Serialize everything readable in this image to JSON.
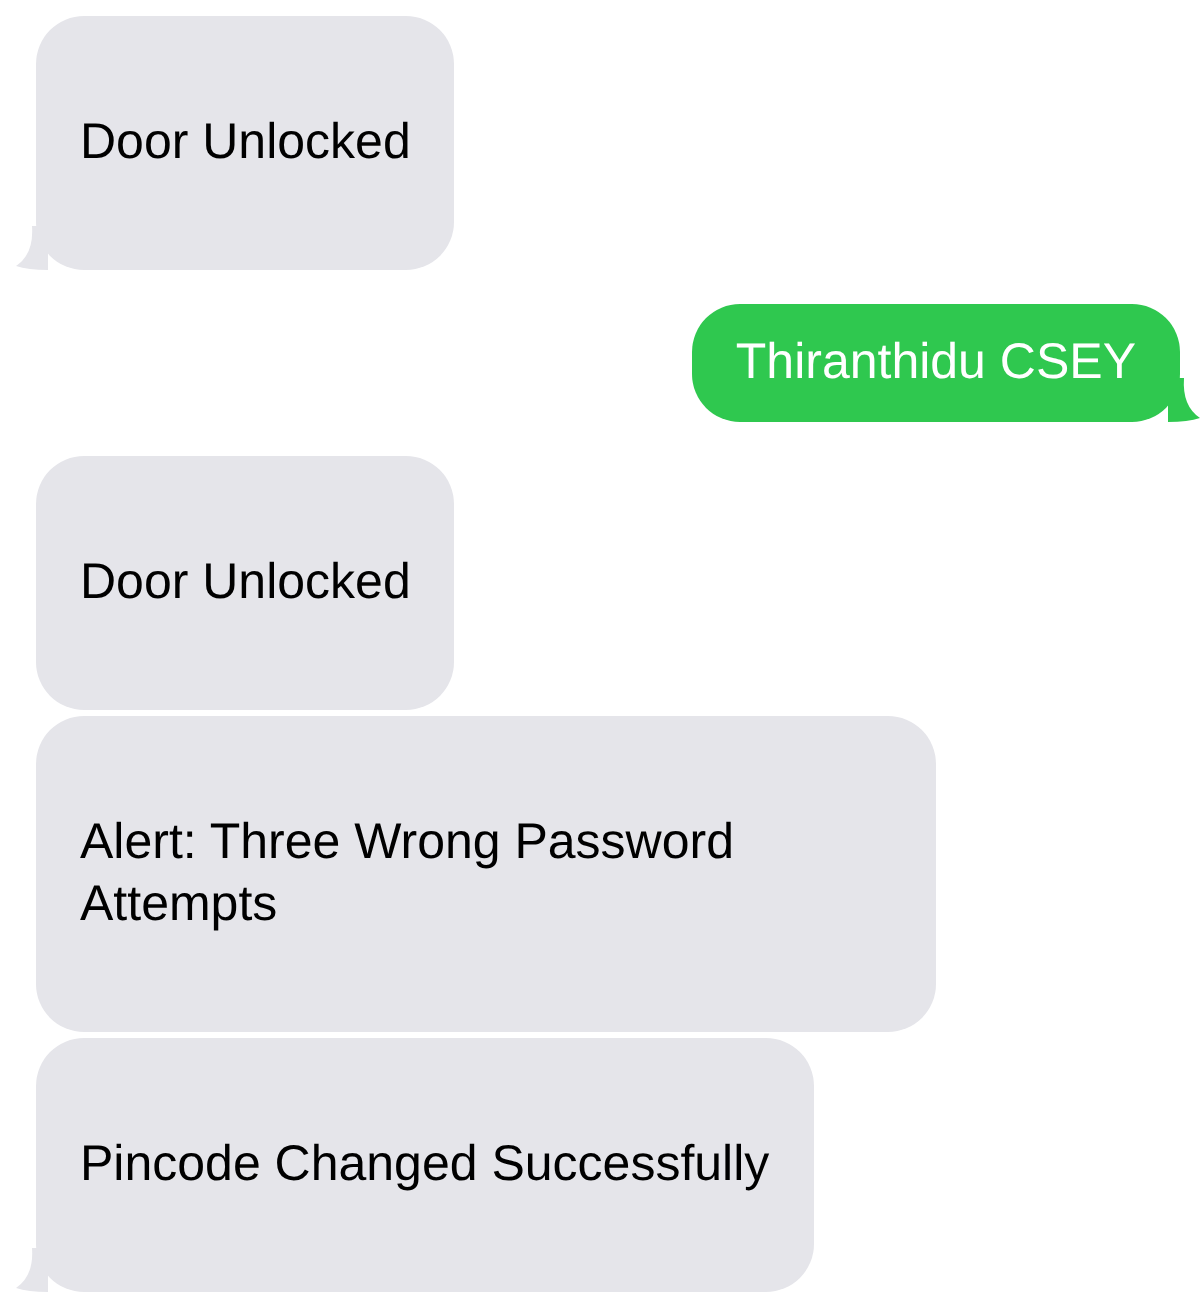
{
  "messages": [
    {
      "kind": "incoming",
      "text": "Door Unlocked",
      "tail": true
    },
    {
      "kind": "outgoing",
      "text": "Thiranthidu CSEY",
      "tail": true
    },
    {
      "kind": "incoming",
      "text": "Door Unlocked",
      "tail": false
    },
    {
      "kind": "incoming",
      "text": "Alert: Three Wrong Password Attempts",
      "tail": false
    },
    {
      "kind": "incoming",
      "text": "Pincode Changed Successfully",
      "tail": true
    }
  ]
}
